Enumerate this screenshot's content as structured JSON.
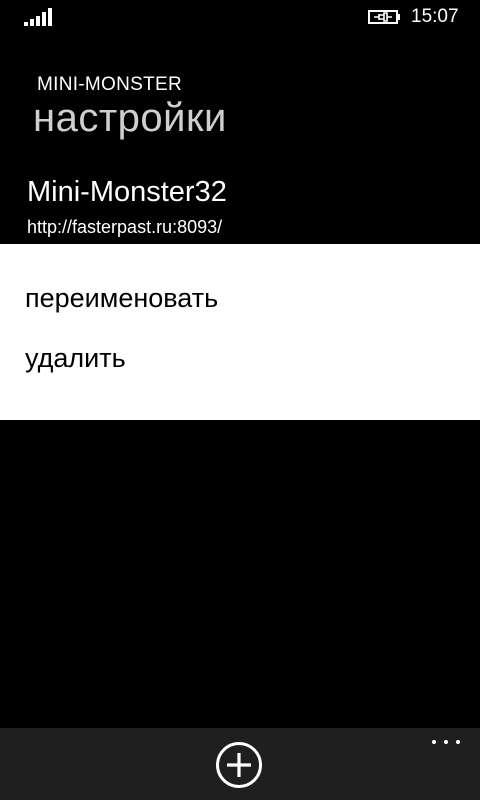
{
  "status_bar": {
    "time": "15:07",
    "signal_icon": "signal-strength-icon",
    "battery_icon": "battery-charging-icon"
  },
  "header": {
    "app_title": "MINI-MONSTER",
    "page_title": "настройки"
  },
  "selected_item": {
    "name": "Mini-Monster32",
    "url": "http://fasterpast.ru:8093/"
  },
  "context_menu": {
    "items": [
      {
        "label": "переименовать"
      },
      {
        "label": "удалить"
      }
    ]
  },
  "app_bar": {
    "add_icon": "add-circle-icon",
    "more_icon": "more-ellipsis-icon"
  },
  "colors": {
    "background": "#000000",
    "menu_background": "#ffffff",
    "app_bar_background": "#1f1f1f",
    "page_title": "#cfcfcf"
  }
}
